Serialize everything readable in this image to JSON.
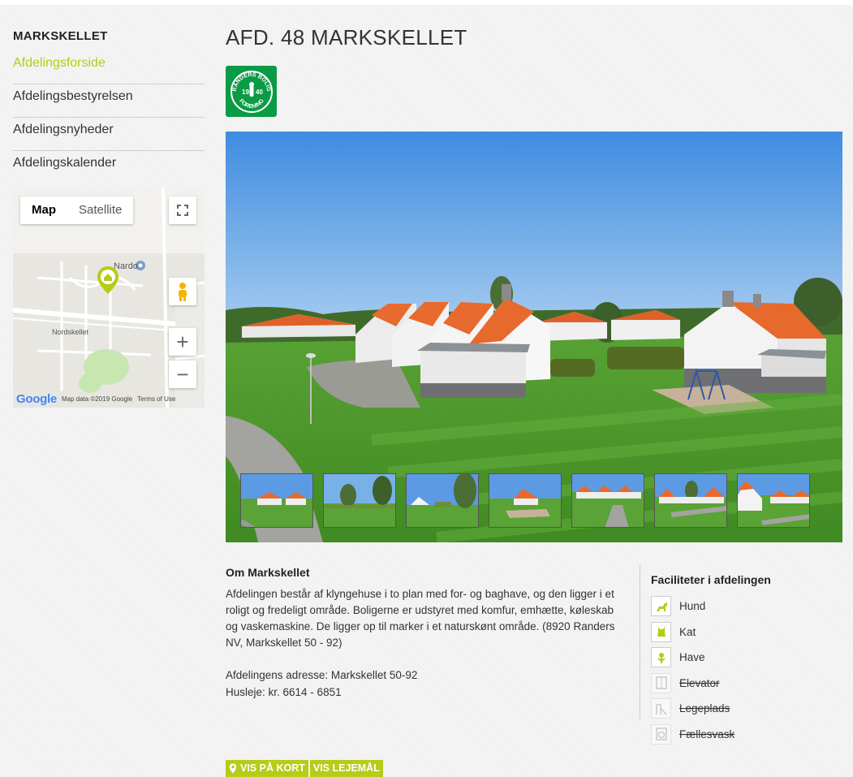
{
  "sidebar": {
    "title": "MARKSKELLET",
    "items": [
      {
        "label": "Afdelingsforside",
        "active": true
      },
      {
        "label": "Afdelingsbestyrelsen",
        "active": false
      },
      {
        "label": "Afdelingsnyheder",
        "active": false
      },
      {
        "label": "Afdelingskalender",
        "active": false
      }
    ]
  },
  "map": {
    "map_label": "Map",
    "satellite_label": "Satellite",
    "street_label": "Nordskellet",
    "poi_label": "Nardo",
    "google_label": "Google",
    "data_label": "Map data ©2019 Google",
    "terms_label": "Terms of Use"
  },
  "page": {
    "title": "AFD. 48 MARKSKELLET"
  },
  "logo": {
    "top_text": "RANDERS BOLIG",
    "year_left": "19",
    "year_right": "40",
    "bottom_text": "FORENING"
  },
  "gallery": {
    "thumbnail_count": 7
  },
  "about": {
    "title": "Om Markskellet",
    "text": "Afdelingen består af klyngehuse i to plan med for- og baghave, og den ligger i et roligt og fredeligt område. Boligerne er udstyret med komfur, emhætte, køleskab og vaskemaskine. De ligger op til marker i et naturskønt område. (8920 Randers NV, Markskellet 50 - 92)",
    "address": "Afdelingens adresse: Markskellet 50-92",
    "rent": "Husleje: kr. 6614 - 6851"
  },
  "facilities": {
    "title": "Faciliteter i afdelingen",
    "items": [
      {
        "label": "Hund",
        "icon": "dog-icon",
        "available": true
      },
      {
        "label": "Kat",
        "icon": "cat-icon",
        "available": true
      },
      {
        "label": "Have",
        "icon": "flower-icon",
        "available": true
      },
      {
        "label": "Elevator",
        "icon": "elevator-icon",
        "available": false
      },
      {
        "label": "Legeplads",
        "icon": "playground-icon",
        "available": false
      },
      {
        "label": "Fællesvask",
        "icon": "washer-icon",
        "available": false
      }
    ]
  },
  "buttons": {
    "show_map": "VIS PÅ KORT",
    "show_leases": "VIS LEJEMÅL"
  },
  "colors": {
    "accent": "#b5cc18",
    "logo_green": "#0a9b45"
  }
}
